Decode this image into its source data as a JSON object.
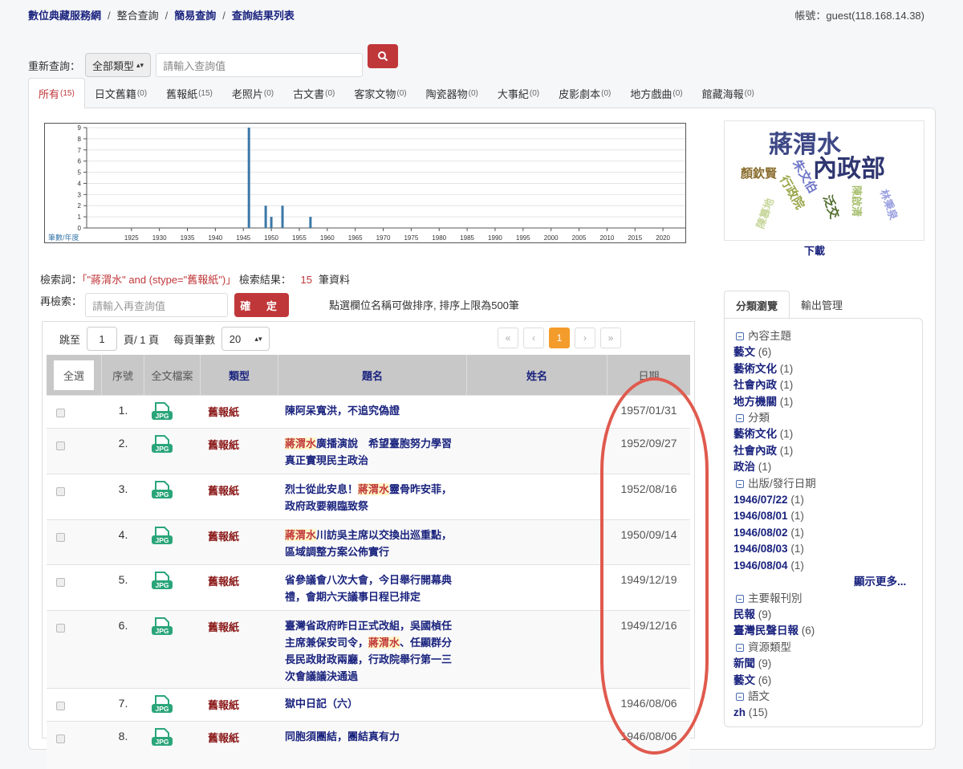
{
  "breadcrumb": [
    "數位典藏服務網",
    "整合查詢",
    "簡易查詢",
    "查詢結果列表"
  ],
  "account": "帳號：guest(118.168.14.38)",
  "requery": {
    "label": "重新查詢：",
    "type_select": "全部類型",
    "placeholder": "請輸入查詢值",
    "search_icon": "search-icon"
  },
  "tabs": [
    {
      "label": "所有",
      "count": "(15)"
    },
    {
      "label": "日文舊籍",
      "count": "(0)"
    },
    {
      "label": "舊報紙",
      "count": "(15)"
    },
    {
      "label": "老照片",
      "count": "(0)"
    },
    {
      "label": "古文書",
      "count": "(0)"
    },
    {
      "label": "客家文物",
      "count": "(0)"
    },
    {
      "label": "陶瓷器物",
      "count": "(0)"
    },
    {
      "label": "大事紀",
      "count": "(0)"
    },
    {
      "label": "皮影劇本",
      "count": "(0)"
    },
    {
      "label": "地方戲曲",
      "count": "(0)"
    },
    {
      "label": "館藏海報",
      "count": "(0)"
    }
  ],
  "chart_data": {
    "type": "bar",
    "title": "",
    "xlabel": "筆數/年度",
    "ylabel": "",
    "x": [
      1946,
      1949,
      1950,
      1952,
      1957
    ],
    "values": [
      9,
      2,
      1,
      2,
      1
    ],
    "xlim": [
      1917,
      2024
    ],
    "ylim": [
      0,
      9
    ],
    "xticks": [
      1925,
      1930,
      1935,
      1940,
      1945,
      1950,
      1955,
      1960,
      1965,
      1970,
      1975,
      1980,
      1985,
      1990,
      1995,
      2000,
      2005,
      2010,
      2015,
      2020
    ],
    "yticks": [
      0,
      1,
      2,
      3,
      4,
      5,
      6,
      7,
      8,
      9
    ],
    "grid": true,
    "color": "#3a78a8"
  },
  "wordcloud": {
    "words": [
      "蔣渭水",
      "內政部",
      "朱文伯",
      "顏欽賢",
      "行政院",
      "陳篡地",
      "泛交",
      "陳啟清",
      "林秉泉"
    ],
    "download": "下載"
  },
  "query": {
    "label": "檢索詞：",
    "expr": "「\"蔣渭水\" and (stype=\"舊報紙\")」",
    "result_label": "檢索結果：",
    "count": "15",
    "unit": "筆資料"
  },
  "refine": {
    "label": "再檢索：",
    "placeholder": "請輸入再查詢值",
    "button": "確 定",
    "hint": "點選欄位名稱可做排序, 排序上限為500筆"
  },
  "pager": {
    "goto": "跳至",
    "page": "1",
    "of": "頁/ 1 頁",
    "per_page_label": "每頁筆數",
    "per_page": "20",
    "first": "«",
    "prev": "‹",
    "current": "1",
    "next": "›",
    "last": "»"
  },
  "columns": [
    "全選",
    "序號",
    "全文檔案",
    "類型",
    "題名",
    "姓名",
    "日期"
  ],
  "rows": [
    {
      "no": "1.",
      "type": "舊報紙",
      "pre": "陳阿呆寬洪，不追究偽證",
      "hl": "",
      "post": "",
      "name": "",
      "date": "1957/01/31"
    },
    {
      "no": "2.",
      "type": "舊報紙",
      "pre": "",
      "hl": "蔣渭水",
      "post": "廣播演說　希望臺胞努力學習　真正實現民主政治",
      "name": "",
      "date": "1952/09/27"
    },
    {
      "no": "3.",
      "type": "舊報紙",
      "pre": "烈士從此安息！",
      "hl": "蔣渭水",
      "post": "靈骨昨安菲，政府政要親臨致祭",
      "name": "",
      "date": "1952/08/16"
    },
    {
      "no": "4.",
      "type": "舊報紙",
      "pre": "",
      "hl": "蔣渭水",
      "post": "川訪吳主席以交換出巡重點，區域調整方案公佈實行",
      "name": "",
      "date": "1950/09/14"
    },
    {
      "no": "5.",
      "type": "舊報紙",
      "pre": "省參議會八次大會，今日舉行開幕典禮，會期六天議事日程已排定",
      "hl": "",
      "post": "",
      "name": "",
      "date": "1949/12/19"
    },
    {
      "no": "6.",
      "type": "舊報紙",
      "pre": "臺灣省政府昨日正式改組，吳國楨任主席兼保安司令，",
      "hl": "蔣渭水",
      "post": "、任顯群分長民政財政兩廳，行政院舉行第一三次會議議決通過",
      "name": "",
      "date": "1949/12/16"
    },
    {
      "no": "7.",
      "type": "舊報紙",
      "pre": "獄中日記（六）",
      "hl": "",
      "post": "",
      "name": "",
      "date": "1946/08/06"
    },
    {
      "no": "8.",
      "type": "舊報紙",
      "pre": "同胞須團結，團結真有力",
      "hl": "",
      "post": "",
      "name": "",
      "date": "1946/08/06"
    }
  ],
  "side": {
    "tabs": [
      "分類瀏覽",
      "輸出管理"
    ],
    "groups": [
      {
        "title": "內容主題",
        "items": [
          [
            "藝文",
            "(6)"
          ],
          [
            "藝術文化",
            "(1)"
          ],
          [
            "社會內政",
            "(1)"
          ],
          [
            "地方機關",
            "(1)"
          ]
        ]
      },
      {
        "title": "分類",
        "items": [
          [
            "藝術文化",
            "(1)"
          ],
          [
            "社會內政",
            "(1)"
          ],
          [
            "政治",
            "(1)"
          ]
        ]
      },
      {
        "title": "出版/發行日期",
        "items": [
          [
            "1946/07/22",
            "(1)"
          ],
          [
            "1946/08/01",
            "(1)"
          ],
          [
            "1946/08/02",
            "(1)"
          ],
          [
            "1946/08/03",
            "(1)"
          ],
          [
            "1946/08/04",
            "(1)"
          ]
        ],
        "more": "顯示更多..."
      },
      {
        "title": "主要報刊別",
        "items": [
          [
            "民報",
            "(9)"
          ],
          [
            "臺灣民聲日報",
            "(6)"
          ]
        ]
      },
      {
        "title": "資源類型",
        "items": [
          [
            "新聞",
            "(9)"
          ],
          [
            "藝文",
            "(6)"
          ]
        ]
      },
      {
        "title": "語文",
        "items": [
          [
            "zh",
            "(15)"
          ]
        ]
      }
    ]
  }
}
